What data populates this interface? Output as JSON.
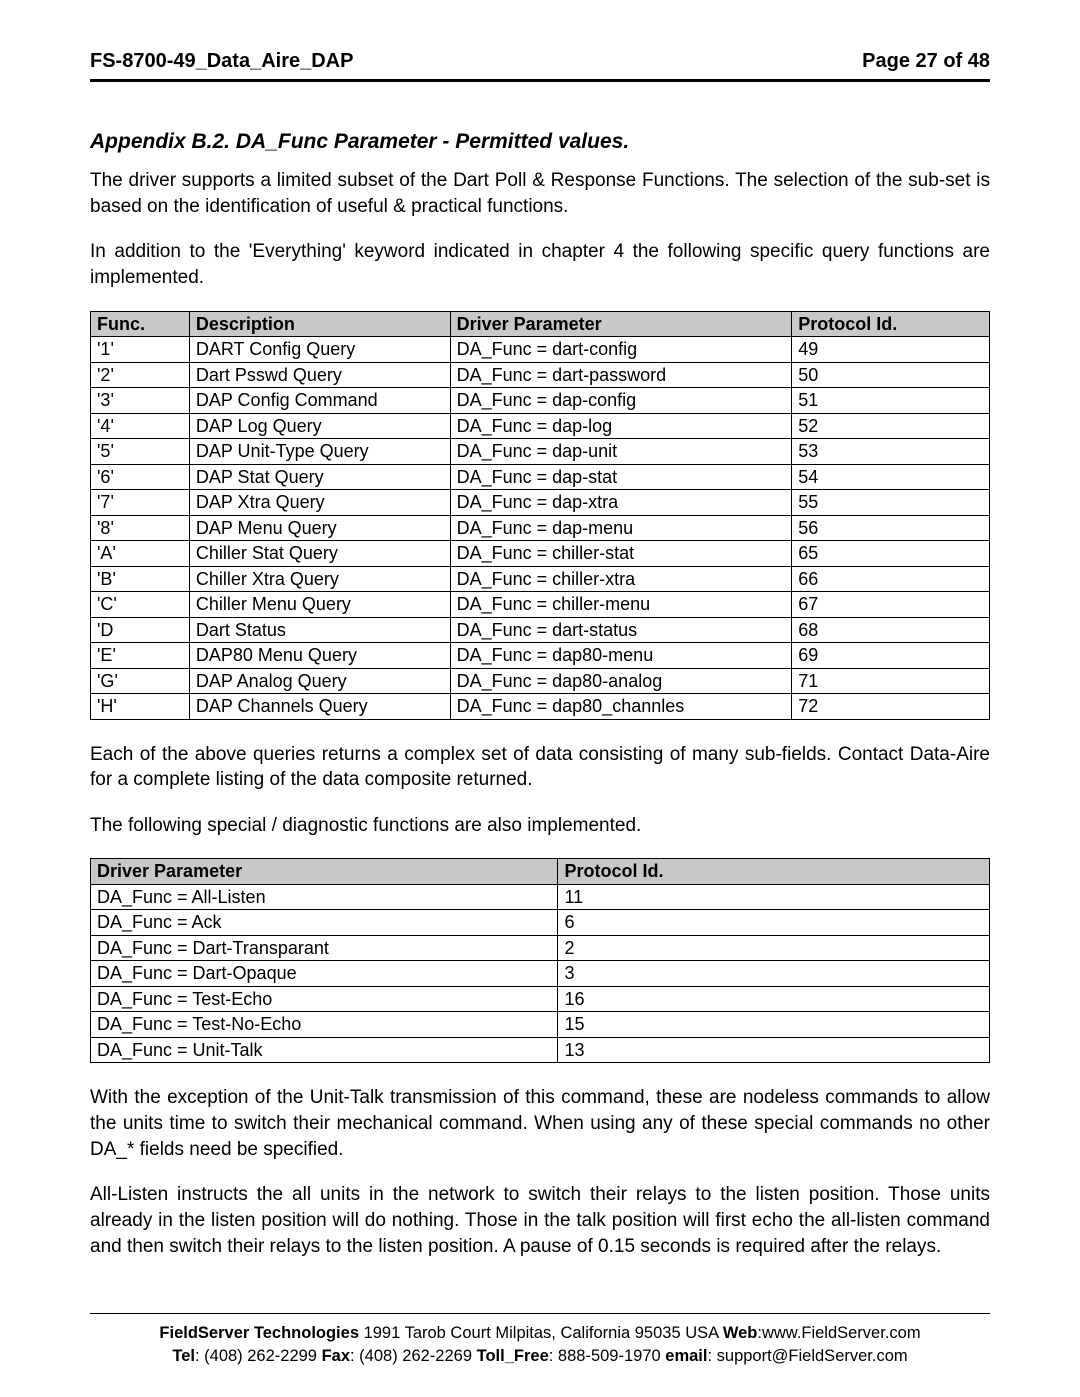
{
  "header": {
    "doc_id": "FS-8700-49_Data_Aire_DAP",
    "page_label": "Page 27 of 48"
  },
  "section_title": "Appendix B.2.   DA_Func Parameter - Permitted values.",
  "para1": "The driver supports a limited subset of the Dart Poll & Response Functions.  The selection of the sub-set is based on the identification of useful & practical functions.",
  "para2": "In addition to the 'Everything' keyword indicated in chapter 4 the following specific query functions are implemented.",
  "table1": {
    "headers": [
      "Func.",
      "Description",
      "Driver Parameter",
      "Protocol Id."
    ],
    "rows": [
      [
        "'1'",
        "DART Config Query",
        "DA_Func = dart-config",
        "49"
      ],
      [
        "'2'",
        "Dart Psswd Query",
        "DA_Func = dart-password",
        "50"
      ],
      [
        "'3'",
        "DAP Config Command",
        "DA_Func = dap-config",
        "51"
      ],
      [
        "'4'",
        "DAP Log Query",
        "DA_Func = dap-log",
        "52"
      ],
      [
        "'5'",
        "DAP Unit-Type Query",
        "DA_Func = dap-unit",
        "53"
      ],
      [
        "'6'",
        "DAP Stat Query",
        "DA_Func = dap-stat",
        "54"
      ],
      [
        "'7'",
        "DAP Xtra Query",
        "DA_Func = dap-xtra",
        "55"
      ],
      [
        "'8'",
        "DAP Menu Query",
        "DA_Func = dap-menu",
        "56"
      ],
      [
        "'A'",
        "Chiller Stat Query",
        "DA_Func = chiller-stat",
        "65"
      ],
      [
        "'B'",
        "Chiller Xtra Query",
        "DA_Func = chiller-xtra",
        "66"
      ],
      [
        "'C'",
        "Chiller Menu Query",
        "DA_Func = chiller-menu",
        "67"
      ],
      [
        "'D",
        "Dart Status",
        "DA_Func = dart-status",
        "68"
      ],
      [
        "'E'",
        "DAP80 Menu Query",
        "DA_Func = dap80-menu",
        "69"
      ],
      [
        "'G'",
        "DAP Analog Query",
        "DA_Func = dap80-analog",
        "71"
      ],
      [
        "'H'",
        "DAP Channels Query",
        "DA_Func = dap80_channles",
        "72"
      ]
    ]
  },
  "para3": "Each of the above queries returns a complex set of data consisting of many sub-fields.  Contact Data-Aire for a complete listing of the data composite returned.",
  "para4": "The following special / diagnostic functions are also implemented.",
  "table2": {
    "headers": [
      "Driver Parameter",
      "Protocol Id."
    ],
    "rows": [
      [
        "DA_Func = All-Listen",
        "11"
      ],
      [
        "DA_Func = Ack",
        "6"
      ],
      [
        "DA_Func = Dart-Transparant",
        "2"
      ],
      [
        "DA_Func = Dart-Opaque",
        "3"
      ],
      [
        "DA_Func = Test-Echo",
        "16"
      ],
      [
        "DA_Func = Test-No-Echo",
        "15"
      ],
      [
        "DA_Func = Unit-Talk",
        "13"
      ]
    ]
  },
  "para5": "With the exception of the Unit-Talk transmission of this command, these are nodeless commands to allow the units time to switch their mechanical command.  When using any of these special commands no other DA_* fields need be specified.",
  "para6": "All-Listen instructs the all units in the network to switch their relays to the listen position.  Those units already in the listen position will do nothing.  Those in the talk position will first echo the all-listen command and then switch their relays to the listen position.  A pause of 0.15 seconds is required after the relays.",
  "footer": {
    "company_label": "FieldServer Technologies",
    "address": " 1991 Tarob Court Milpitas, California 95035 USA  ",
    "web_label": "Web",
    "web_value": ":www.FieldServer.com",
    "tel_label": "Tel",
    "tel_value": ": (408) 262-2299  ",
    "fax_label": "Fax",
    "fax_value": ": (408) 262-2269  ",
    "tollfree_label": "Toll_Free",
    "tollfree_value": ": 888-509-1970  ",
    "email_label": "email",
    "email_value": ": support@FieldServer.com"
  }
}
